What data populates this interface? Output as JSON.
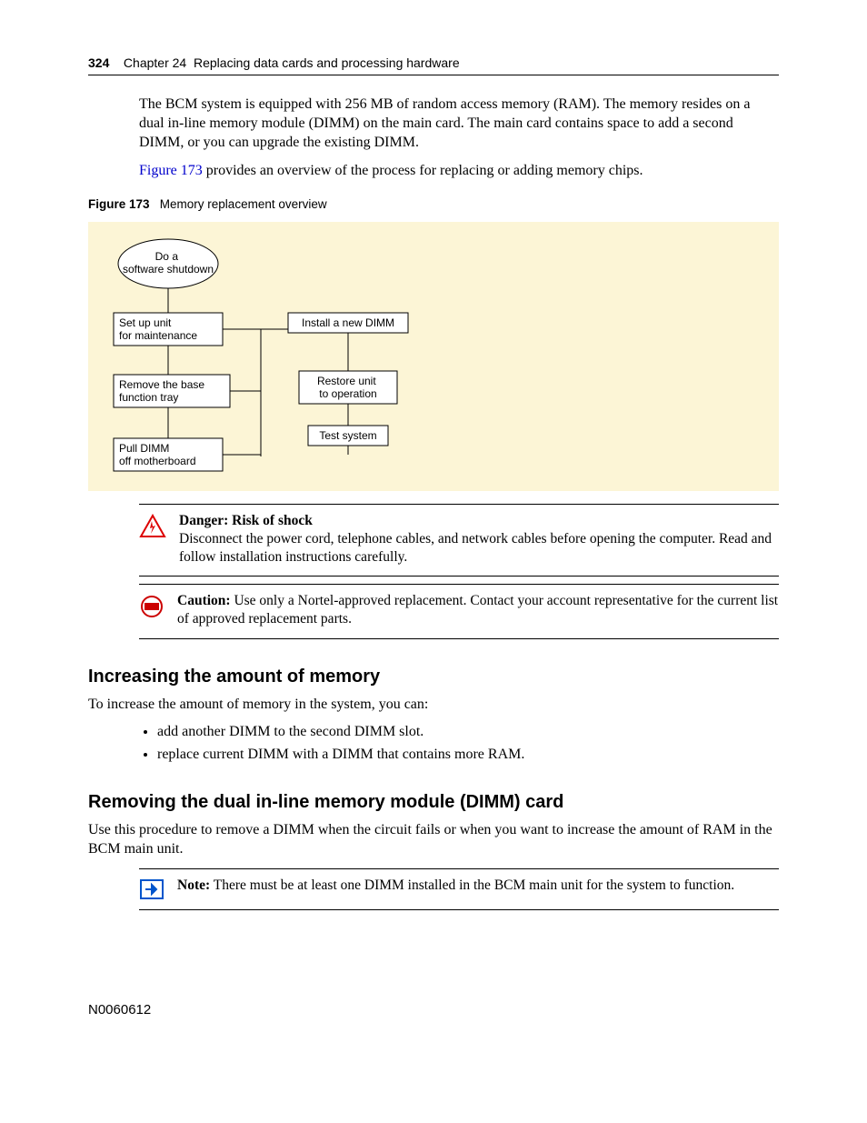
{
  "header": {
    "page_number": "324",
    "chapter_label": "Chapter 24",
    "chapter_title": "Replacing data cards and processing hardware"
  },
  "intro": {
    "p1": "The BCM system is equipped with 256 MB of random access memory (RAM). The memory resides on a dual in-line memory module (DIMM) on the main card. The main card contains space to add a second DIMM, or you can upgrade the existing DIMM.",
    "p2_link": "Figure 173",
    "p2_rest": " provides an overview of the process for replacing or adding memory chips."
  },
  "figure": {
    "label": "Figure 173",
    "caption": "Memory replacement overview"
  },
  "flow": {
    "step1": "Do a software shutdown",
    "step2a": "Set up unit for maintenance",
    "step3a": "Remove the base function tray",
    "step4a": "Pull DIMM off motherboard",
    "step2b": "Install a new DIMM",
    "step3b": "Restore unit to operation",
    "step4b": "Test system"
  },
  "danger": {
    "title": "Danger:",
    "subtitle": "Risk of shock",
    "body": "Disconnect the power cord, telephone cables, and network cables before opening the computer. Read and follow installation instructions carefully."
  },
  "caution": {
    "title": "Caution:",
    "body": " Use only a Nortel-approved replacement. Contact your account representative for the current list of approved replacement parts."
  },
  "section1": {
    "heading": "Increasing the amount of memory",
    "intro": "To increase the amount of memory in the system, you can:",
    "bullet1": "add another DIMM to the second DIMM slot.",
    "bullet2": "replace current DIMM with a DIMM that contains more RAM."
  },
  "section2": {
    "heading": "Removing the dual in-line memory module (DIMM) card",
    "intro": "Use this procedure to remove a DIMM when the circuit fails or when you want to increase the amount of RAM in the BCM main unit."
  },
  "note": {
    "title": "Note:",
    "body": " There must be at least one DIMM installed in the BCM main unit for the system to function."
  },
  "footer": {
    "doc_id": "N0060612"
  }
}
